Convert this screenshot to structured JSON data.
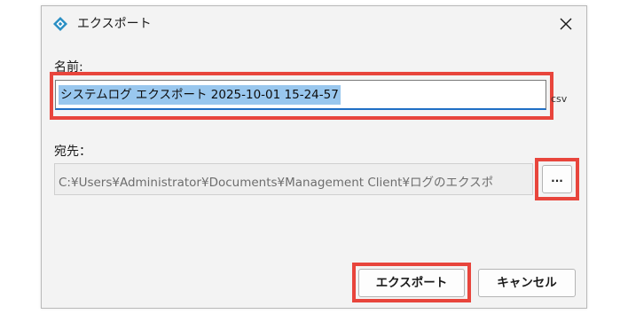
{
  "window": {
    "title": "エクスポート",
    "icon": "app-diamond-icon",
    "close_icon": "close-icon"
  },
  "form": {
    "name_label": "名前:",
    "name_value": "システムログ エクスポート 2025-10-01 15-24-57",
    "name_suffix": "csv",
    "destination_label": "宛先：",
    "destination_value": "C:¥Users¥Administrator¥Documents¥Management Client¥ログのエクスポ",
    "browse_label": "..."
  },
  "buttons": {
    "export_label": "エクスポート",
    "cancel_label": "キャンセル"
  },
  "colors": {
    "highlight": "#e8453c",
    "selection": "#99c7ee",
    "focus_underline": "#1f6fc5",
    "icon_accent": "#2a8fc4"
  }
}
